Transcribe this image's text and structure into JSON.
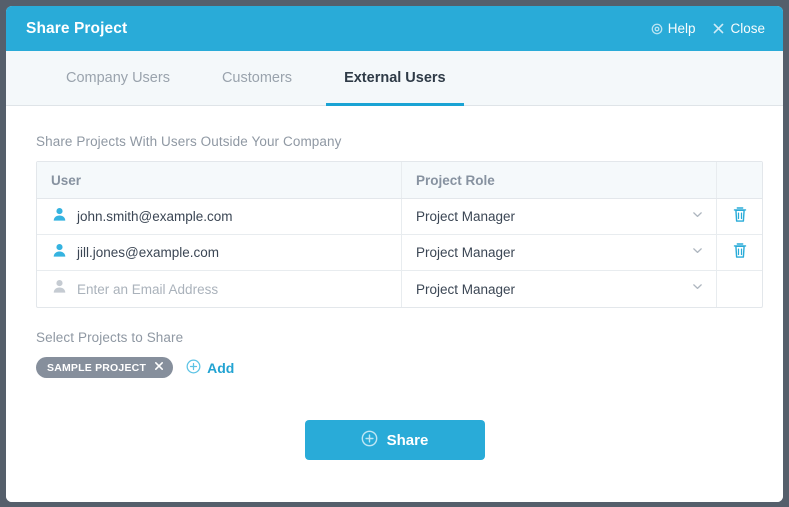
{
  "window": {
    "title": "Share Project",
    "help_label": "Help",
    "help_icon": "lifebuoy-icon",
    "close_label": "Close",
    "close_icon": "close-x-icon"
  },
  "tabs": [
    {
      "label": "Company Users",
      "active": false
    },
    {
      "label": "Customers",
      "active": false
    },
    {
      "label": "External Users",
      "active": true
    }
  ],
  "main": {
    "section_label": "Share Projects With Users Outside Your Company",
    "table": {
      "columns": [
        "User",
        "Project Role",
        ""
      ],
      "rows": [
        {
          "email": "john.smith@example.com",
          "role": "Project Manager",
          "is_placeholder": false,
          "has_delete": true
        },
        {
          "email": "jill.jones@example.com",
          "role": "Project Manager",
          "is_placeholder": false,
          "has_delete": true
        },
        {
          "email": "Enter an Email Address",
          "role": "Project Manager",
          "is_placeholder": true,
          "has_delete": false
        }
      ],
      "user_icon": "user-icon",
      "chevron_icon": "chevron-down-icon",
      "delete_icon": "trash-icon"
    },
    "projects": {
      "label": "Select Projects to Share",
      "chips": [
        {
          "label": "SAMPLE PROJECT",
          "remove_icon": "close-x-icon"
        }
      ],
      "add_label": "Add",
      "add_icon": "plus-circle-icon"
    },
    "share": {
      "label": "Share",
      "icon": "plus-circle-icon"
    }
  },
  "colors": {
    "accent": "#29abd8",
    "accent_link": "#22a3d2",
    "backdrop": "#555f6b",
    "chip": "#868f9c",
    "tabbar": "#f4f8fa",
    "table_header": "#f5f9fb",
    "text_dark": "#3b4654",
    "text_muted": "#8f98a3"
  }
}
